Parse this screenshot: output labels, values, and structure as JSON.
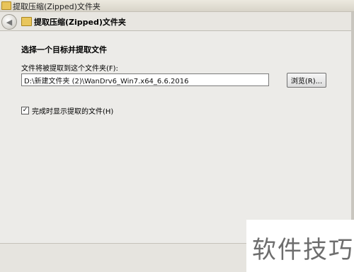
{
  "window": {
    "title": "提取压缩(Zipped)文件夹"
  },
  "navbar": {
    "title": "提取压缩(Zipped)文件夹"
  },
  "main": {
    "heading": "选择一个目标并提取文件",
    "field_label": "文件将被提取到这个文件夹(F):",
    "path_value": "D:\\新建文件夹 (2)\\WanDrv6_Win7.x64_6.6.2016",
    "browse_label": "浏览(R)...",
    "checkbox_label": "完成时显示提取的文件(H)",
    "checkbox_checked": true
  },
  "watermark": {
    "text": "软件技巧"
  }
}
